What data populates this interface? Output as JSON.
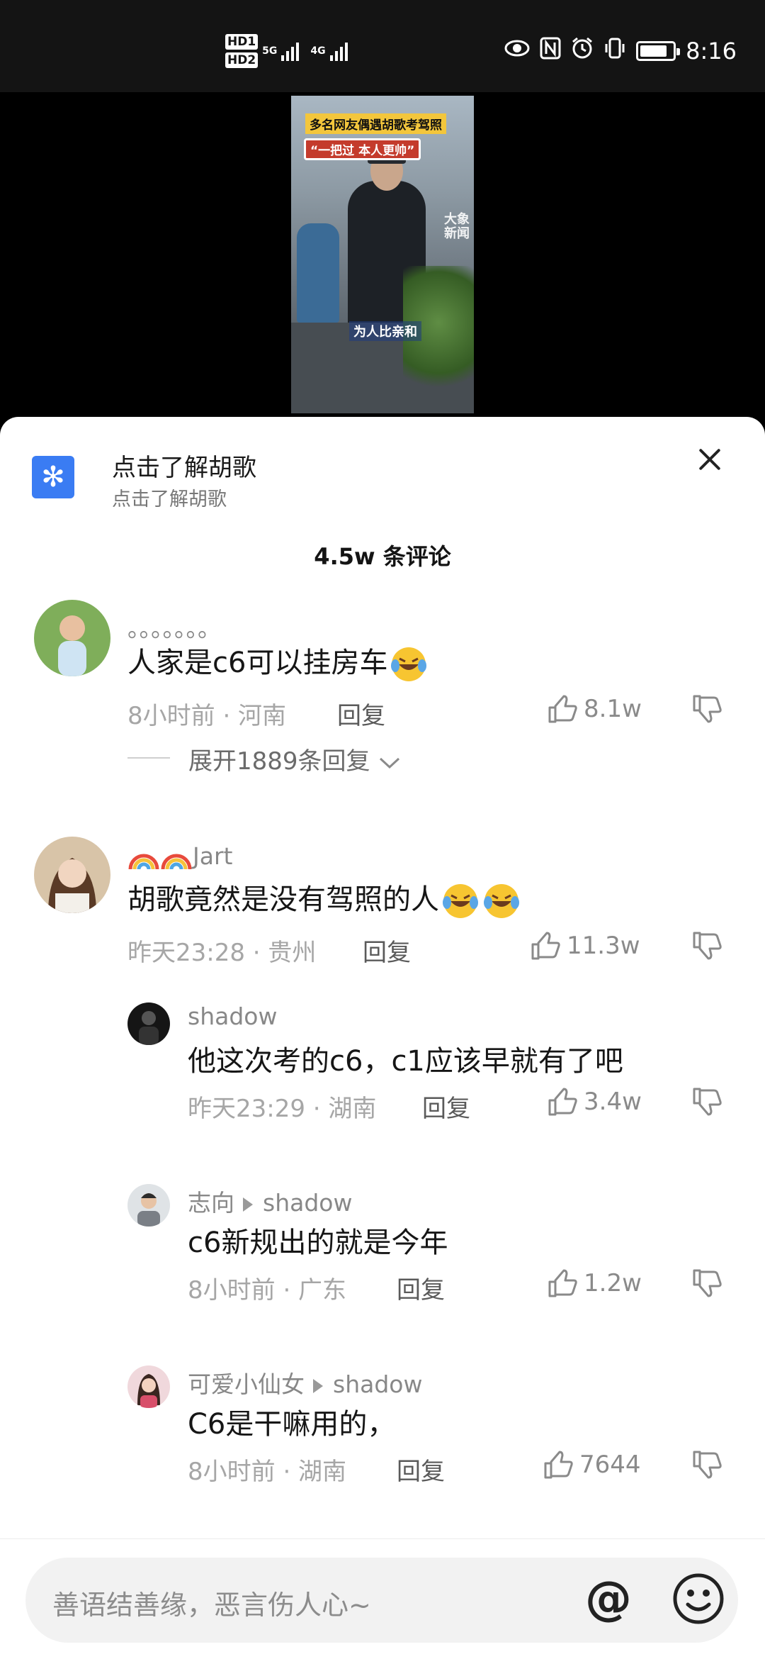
{
  "status_bar": {
    "hd1": "HD1",
    "hd2": "HD2",
    "net1": "5G",
    "net2": "4G",
    "time": "8:16",
    "battery_level": 0.85,
    "icons": [
      "eye-icon",
      "nfc-icon",
      "alarm-icon",
      "vibrate-icon",
      "battery-icon"
    ]
  },
  "video": {
    "title": "多名网友偶遇胡歌考驾照",
    "subtitle": "“一把过 本人更帅”",
    "caption": "为人比亲和",
    "watermark": "大象新闻"
  },
  "promo": {
    "title": "点击了解胡歌",
    "subtitle": "点击了解胡歌",
    "icon": "asterisk-app-icon"
  },
  "comment_count": "4.5w 条评论",
  "comments": [
    {
      "name": "。。。。。。。",
      "text": "人家是c6可以挂房车",
      "meta": "8小时前 · 河南",
      "reply": "回复",
      "likes": "8.1w",
      "expand": "展开1889条回复"
    },
    {
      "name": "Jart",
      "text": "胡歌竟然是没有驾照的人",
      "meta": "昨天23:28 · 贵州",
      "reply": "回复",
      "likes": "11.3w"
    }
  ],
  "replies": [
    {
      "name": "shadow",
      "text": "他这次考的c6，c1应该早就有了吧",
      "meta": "昨天23:29 · 湖南",
      "reply": "回复",
      "likes": "3.4w"
    },
    {
      "name": "志向",
      "target": "shadow",
      "text": "c6新规出的就是今年",
      "meta": "8小时前 · 广东",
      "reply": "回复",
      "likes": "1.2w"
    },
    {
      "name": "可爱小仙女",
      "target": "shadow",
      "text": "C6是干嘛用的，",
      "meta": "8小时前 · 湖南",
      "reply": "回复",
      "likes": "7644"
    }
  ],
  "input": {
    "placeholder": "善语结善缘，恶言伤人心~",
    "at_label": "@"
  }
}
